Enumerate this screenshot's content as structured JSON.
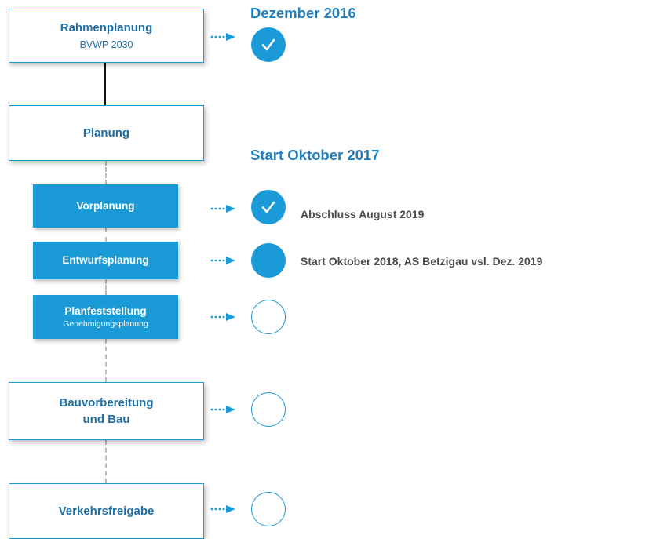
{
  "colors": {
    "accent": "#1a9ad6",
    "title_blue": "#1f7fbf",
    "note_gray": "#4a4a4a"
  },
  "stages": {
    "rahmenplanung": {
      "title": "Rahmenplanung",
      "subtitle": "BVWP 2030"
    },
    "planung": {
      "title": "Planung"
    },
    "vorplanung": {
      "title": "Vorplanung"
    },
    "entwurfsplanung": {
      "title": "Entwurfsplanung"
    },
    "planfeststellung": {
      "title": "Planfeststellung",
      "subtitle": "Genehmigungsplanung"
    },
    "bau": {
      "title_line1": "Bauvorbereitung",
      "title_line2": "und Bau"
    },
    "verkehrsfreigabe": {
      "title": "Verkehrsfreigabe"
    }
  },
  "annotations": {
    "dezember_2016": "Dezember 2016",
    "start_oktober_2017": "Start Oktober 2017",
    "vorplanung_note": "Abschluss August 2019",
    "entwurfsplanung_note": "Start Oktober 2018, AS Betzigau vsl. Dez. 2019"
  },
  "status": {
    "rahmenplanung": "done",
    "vorplanung": "done",
    "entwurfsplanung": "in-progress",
    "planfeststellung": "open",
    "bau": "open",
    "verkehrsfreigabe": "open"
  },
  "icons": {
    "check": "check-icon",
    "arrow": "dotted-arrow-icon"
  }
}
